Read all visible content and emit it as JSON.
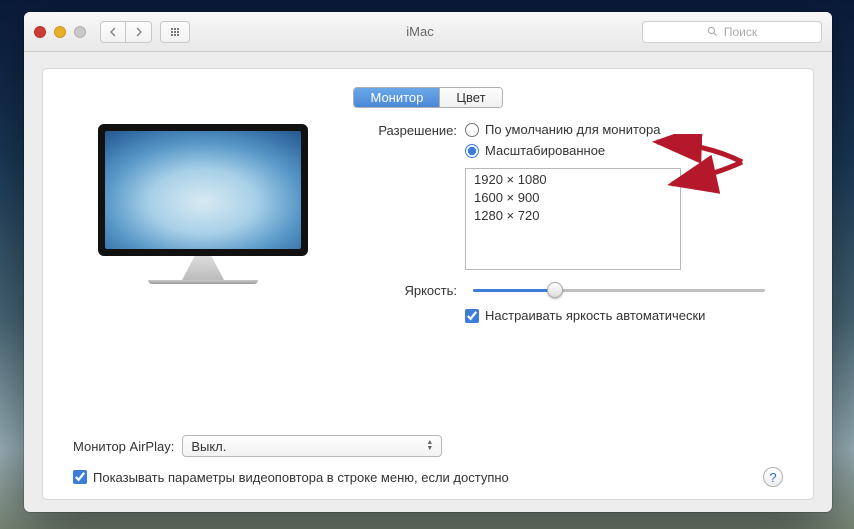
{
  "window": {
    "title": "iMac"
  },
  "toolbar": {
    "search_placeholder": "Поиск"
  },
  "tabs": {
    "monitor": "Монитор",
    "color": "Цвет"
  },
  "resolution": {
    "label": "Разрешение:",
    "option_default": "По умолчанию для монитора",
    "option_scaled": "Масштабированное",
    "list": [
      "1920 × 1080",
      "1600 × 900",
      "1280 × 720"
    ]
  },
  "brightness": {
    "label": "Яркость:",
    "auto_checkbox": "Настраивать яркость автоматически"
  },
  "airplay": {
    "label": "Монитор AirPlay:",
    "value": "Выкл."
  },
  "footer": {
    "show_mirroring": "Показывать параметры видеоповтора в строке меню, если доступно"
  },
  "colors": {
    "accent": "#3b7dd8",
    "arrow": "#b5182a"
  }
}
